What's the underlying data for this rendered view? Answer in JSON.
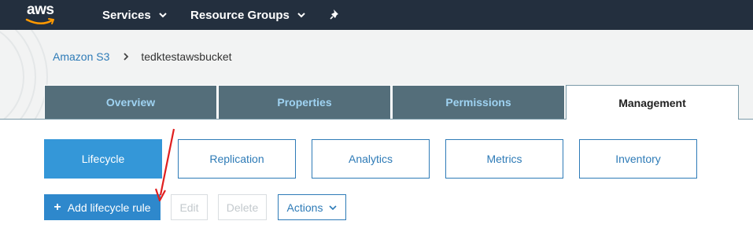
{
  "topnav": {
    "logo_text": "aws",
    "services_label": "Services",
    "resource_groups_label": "Resource Groups",
    "pin_icon": "pin-icon"
  },
  "breadcrumb": {
    "root": "Amazon S3",
    "current": "tedktestawsbucket"
  },
  "tabs": [
    {
      "label": "Overview",
      "active": false
    },
    {
      "label": "Properties",
      "active": false
    },
    {
      "label": "Permissions",
      "active": false
    },
    {
      "label": "Management",
      "active": true
    }
  ],
  "subtabs": [
    {
      "label": "Lifecycle",
      "active": true
    },
    {
      "label": "Replication",
      "active": false
    },
    {
      "label": "Analytics",
      "active": false
    },
    {
      "label": "Metrics",
      "active": false
    },
    {
      "label": "Inventory",
      "active": false
    }
  ],
  "actions": {
    "add_label": "Add lifecycle rule",
    "edit_label": "Edit",
    "delete_label": "Delete",
    "actions_label": "Actions"
  },
  "colors": {
    "nav_bg": "#232f3e",
    "tab_inactive_bg": "#546e7a",
    "tab_inactive_text": "#9fd3f2",
    "primary": "#3497d8",
    "link": "#2e7bb7",
    "annotation_arrow": "#e02020"
  }
}
